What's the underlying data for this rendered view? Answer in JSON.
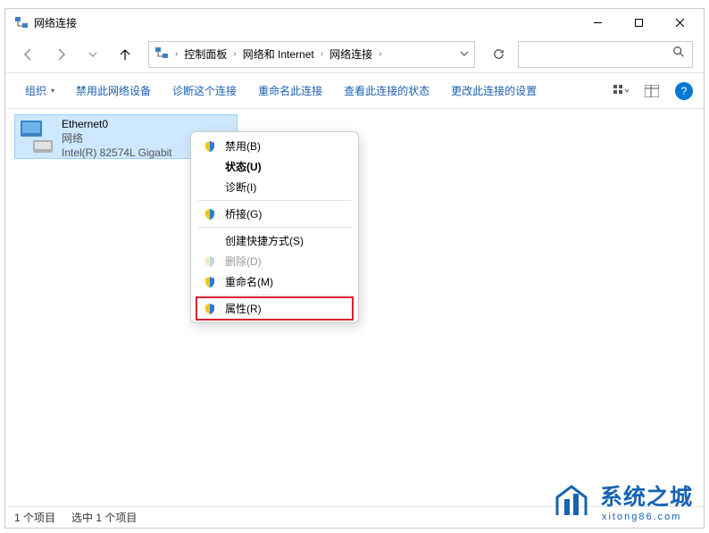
{
  "window": {
    "title": "网络连接"
  },
  "nav": {
    "breadcrumbs": [
      "控制面板",
      "网络和 Internet",
      "网络连接"
    ],
    "search_placeholder": ""
  },
  "toolbar": {
    "organize": "组织",
    "disable": "禁用此网络设备",
    "diagnose": "诊断这个连接",
    "rename": "重命名此连接",
    "view_status": "查看此连接的状态",
    "change_settings": "更改此连接的设置"
  },
  "connection": {
    "name": "Ethernet0",
    "status": "网络",
    "device": "Intel(R) 82574L Gigabit"
  },
  "context_menu": {
    "items": [
      {
        "label": "禁用(B)",
        "shield": true
      },
      {
        "label": "状态(U)",
        "bold": true
      },
      {
        "label": "诊断(I)"
      },
      {
        "label": "桥接(G)",
        "shield": true
      },
      {
        "label": "创建快捷方式(S)"
      },
      {
        "label": "删除(D)",
        "shield": true,
        "disabled": true
      },
      {
        "label": "重命名(M)",
        "shield": true
      },
      {
        "label": "属性(R)",
        "shield": true,
        "highlight": true
      }
    ]
  },
  "statusbar": {
    "count": "1 个项目",
    "selected": "选中 1 个项目"
  },
  "watermark": {
    "title": "系统之城",
    "url": "xitong86.com"
  }
}
